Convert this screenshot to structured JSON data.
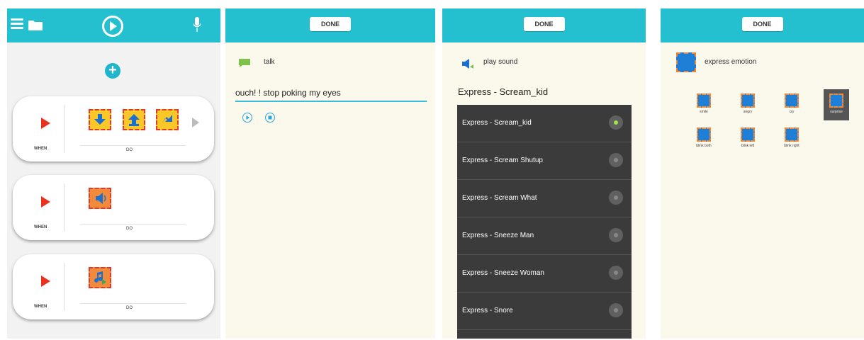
{
  "panel1": {
    "cards": [
      {
        "when": "WHEN",
        "do": "DO"
      },
      {
        "when": "WHEN",
        "do": "DO"
      },
      {
        "when": "WHEN",
        "do": "DO"
      }
    ]
  },
  "panel2": {
    "done": "DONE",
    "action_label": "talk",
    "text_value": "ouch! ! stop poking my eyes"
  },
  "panel3": {
    "done": "DONE",
    "action_label": "play sound",
    "selected": "Express - Scream_kid",
    "options": [
      "Express - Scream_kid",
      "Express - Scream Shutup",
      "Express - Scream What",
      "Express - Sneeze Man",
      "Express - Sneeze Woman",
      "Express - Snore"
    ]
  },
  "panel4": {
    "done": "DONE",
    "action_label": "express emotion",
    "emotions": [
      "smile",
      "angry",
      "cry",
      "surprise",
      "blink both",
      "blink left",
      "blink right"
    ]
  },
  "colors": {
    "topbar": "#25c0cf",
    "accent_red": "#e8321e",
    "block_yellow": "#f9c727",
    "block_orange": "#f28a3b"
  }
}
